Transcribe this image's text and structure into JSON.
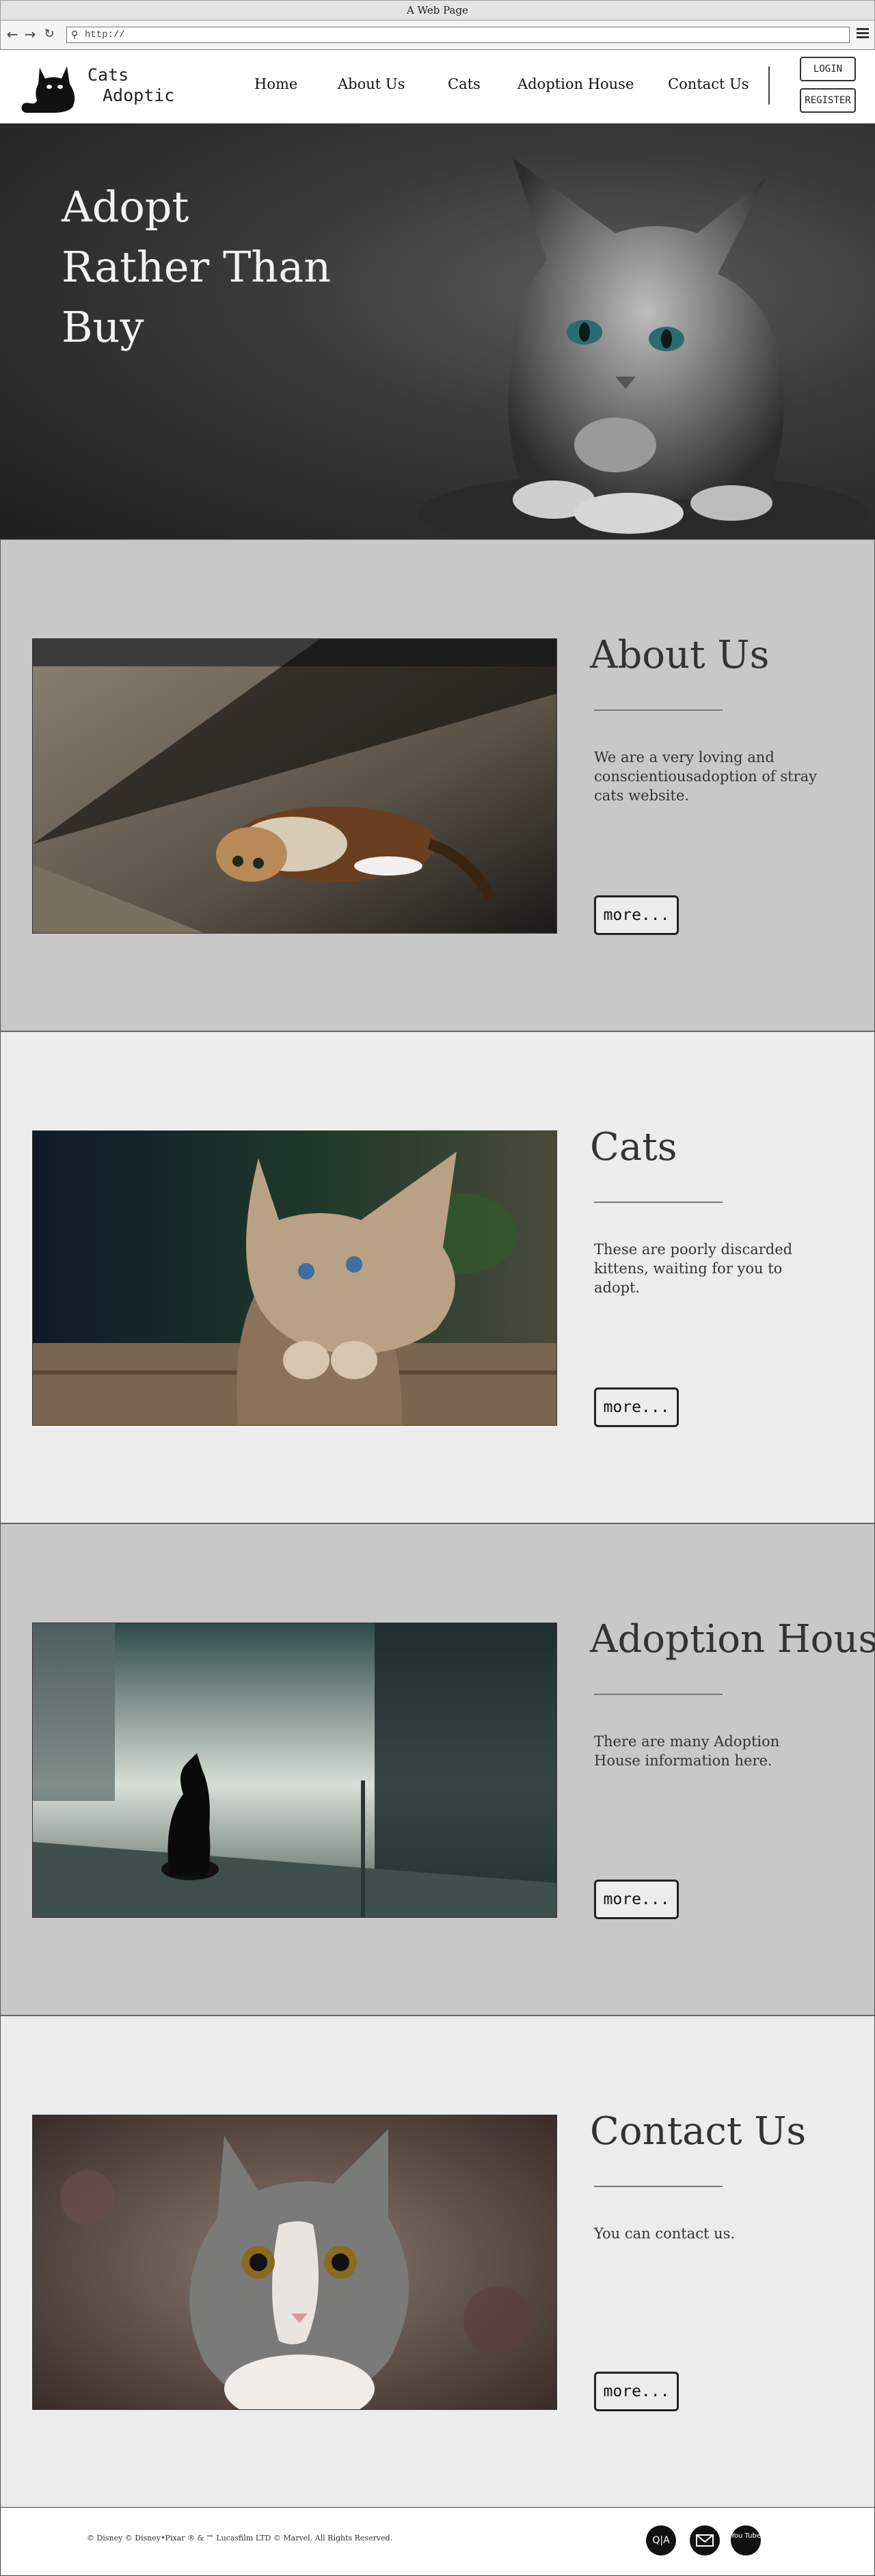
{
  "window": {
    "title": "A Web Page"
  },
  "browser": {
    "url": "http://"
  },
  "header": {
    "logo_line1": "Cats",
    "logo_line2": "Adoptic",
    "nav": [
      "Home",
      "About Us",
      "Cats",
      "Adoption House",
      "Contact Us"
    ],
    "login": "LOGIN",
    "register": "REGISTER"
  },
  "hero": {
    "line1": "Adopt",
    "line2": "Rather Than",
    "line3": "Buy"
  },
  "sections": [
    {
      "title": "About Us",
      "desc": "We are a very loving and conscientiousadoption of stray cats website.",
      "button": "more..."
    },
    {
      "title": "Cats",
      "desc": "These are poorly discarded kittens, waiting for you to adopt.",
      "button": "more..."
    },
    {
      "title": "Adoption House",
      "desc": "There are many Adoption House information here.",
      "button": "more..."
    },
    {
      "title": "Contact Us",
      "desc": "You can contact us.",
      "button": "more..."
    }
  ],
  "footer": {
    "copyright": "© Disney © Disney•Pixar ® & ™ Lucasfilm LTD © Marvel. All Rights Reserved.",
    "social": [
      "Q|A",
      "mail",
      "You Tube"
    ]
  },
  "icons": {
    "back": "back-arrow-icon",
    "forward": "forward-arrow-icon",
    "reload": "reload-icon",
    "search": "search-icon",
    "menu": "hamburger-menu-icon",
    "logo": "cat-logo-icon"
  }
}
